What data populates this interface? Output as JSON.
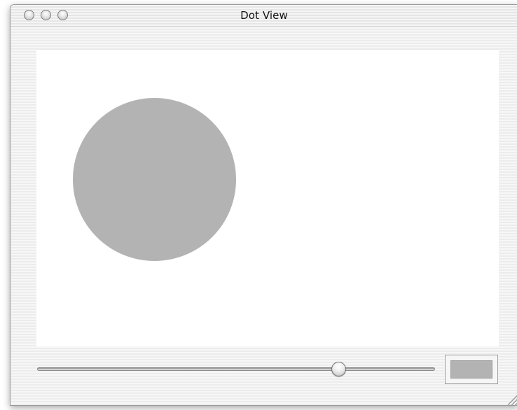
{
  "window": {
    "title": "Dot View",
    "controls": {
      "close_icon": "close-window-icon",
      "minimize_icon": "minimize-window-icon",
      "zoom_icon": "zoom-window-icon"
    }
  },
  "dot": {
    "color": "#b3b3b3"
  },
  "slider": {
    "value_fraction": 0.81
  },
  "color_well": {
    "color": "#b3b3b3"
  }
}
